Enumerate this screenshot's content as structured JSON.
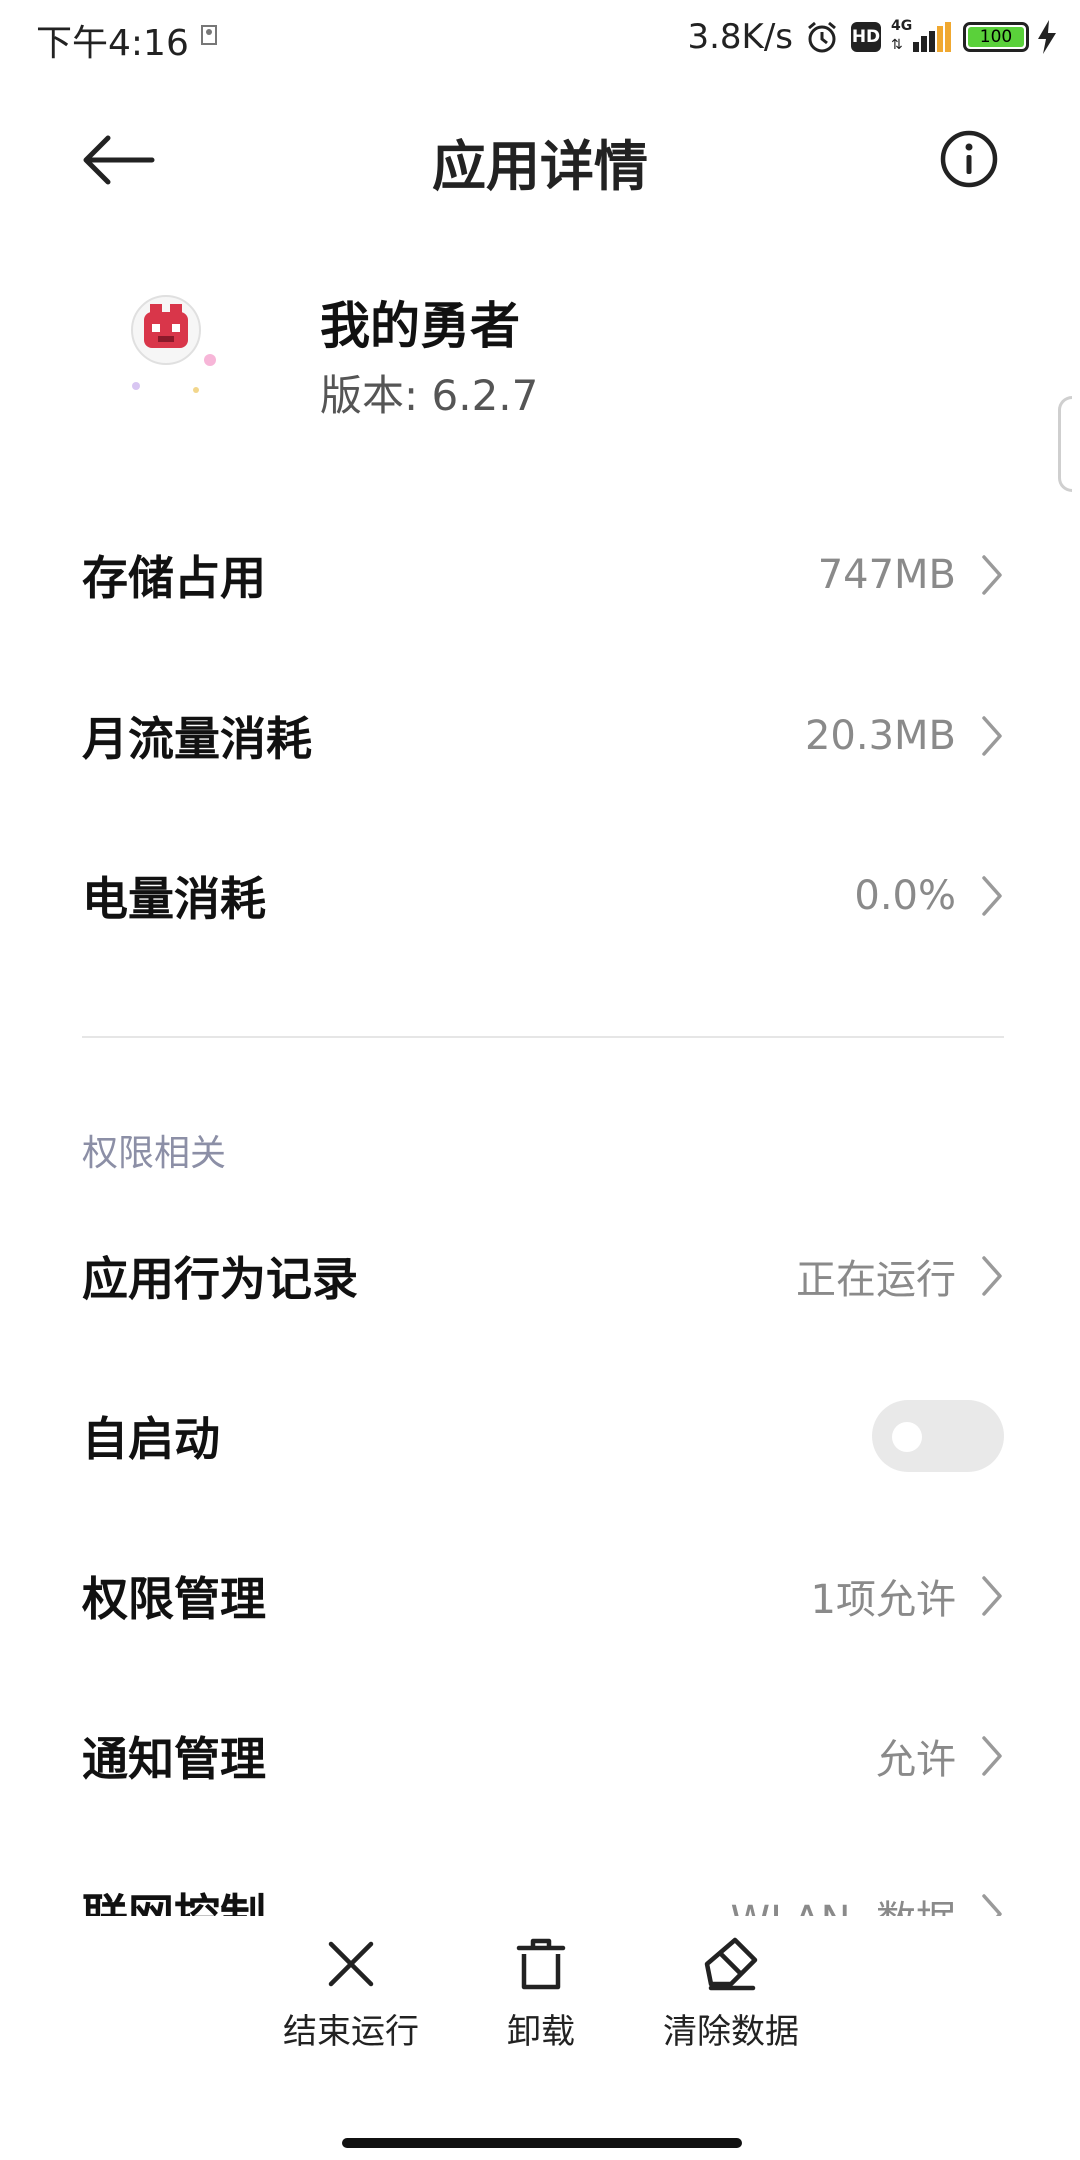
{
  "status_bar": {
    "time": "下午4:16",
    "net_speed": "3.8K/s",
    "hd": "HD",
    "network": "4G",
    "battery": "100"
  },
  "header": {
    "title": "应用详情"
  },
  "app": {
    "name": "我的勇者",
    "version": "版本: 6.2.7"
  },
  "usage_rows": [
    {
      "label": "存储占用",
      "value": "747MB"
    },
    {
      "label": "月流量消耗",
      "value": "20.3MB"
    },
    {
      "label": "电量消耗",
      "value": "0.0%"
    }
  ],
  "permissions": {
    "section_title": "权限相关",
    "rows": [
      {
        "label": "应用行为记录",
        "value": "正在运行"
      },
      {
        "label": "自启动",
        "toggle_on": false
      },
      {
        "label": "权限管理",
        "value": "1项允许"
      },
      {
        "label": "通知管理",
        "value": "允许"
      },
      {
        "label": "联网控制",
        "value": "WLAN, 数据"
      }
    ]
  },
  "actions": [
    {
      "label": "结束运行",
      "icon": "close-icon"
    },
    {
      "label": "卸载",
      "icon": "trash-icon"
    },
    {
      "label": "清除数据",
      "icon": "eraser-icon"
    }
  ],
  "colors": {
    "accent_gray": "#8a8a8a",
    "section_title": "#8c8fa6",
    "battery_fill": "#5ad13a"
  }
}
